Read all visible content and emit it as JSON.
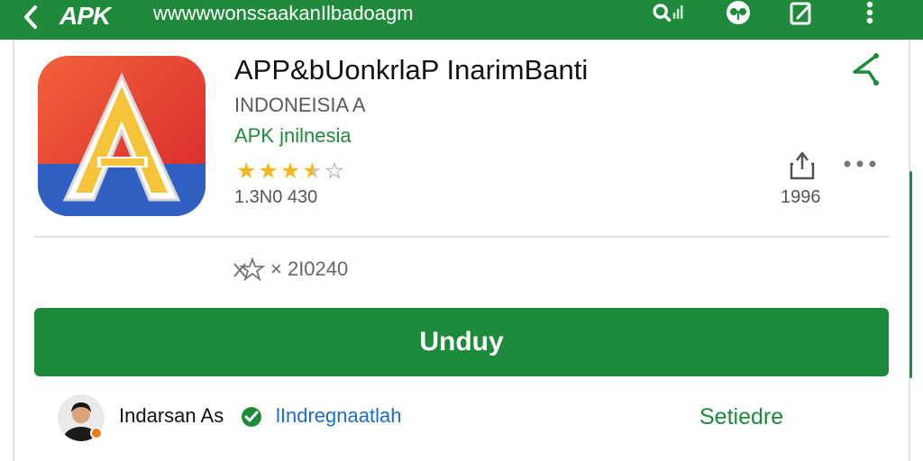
{
  "topbar": {
    "logo": "APK",
    "url": "wwwwwonssaakanIlbadoagm",
    "icons": [
      "back-arrow-icon",
      "search-signal-icon",
      "notification-icon",
      "edit-icon",
      "more-vertical-icon"
    ]
  },
  "app": {
    "title": "APP&bUonkrlaP InarimBanti",
    "developer": "INDONEISIA A",
    "category": "APK jnilnesia",
    "rating": 3.5,
    "rating_max": 5,
    "review_count": "1.3N0 430",
    "size_value": "1996"
  },
  "meta": {
    "prefix_icon": "star-close-icon",
    "value": "× 2I0240"
  },
  "download": {
    "label": "Unduy"
  },
  "author": {
    "name": "Indarsan As",
    "link": "lIndregnaatlah",
    "follow_label": "Setiedre"
  },
  "colors": {
    "brand_green": "#1f8a3b",
    "star_yellow": "#f2b91e",
    "link_blue": "#1a6fc4"
  }
}
